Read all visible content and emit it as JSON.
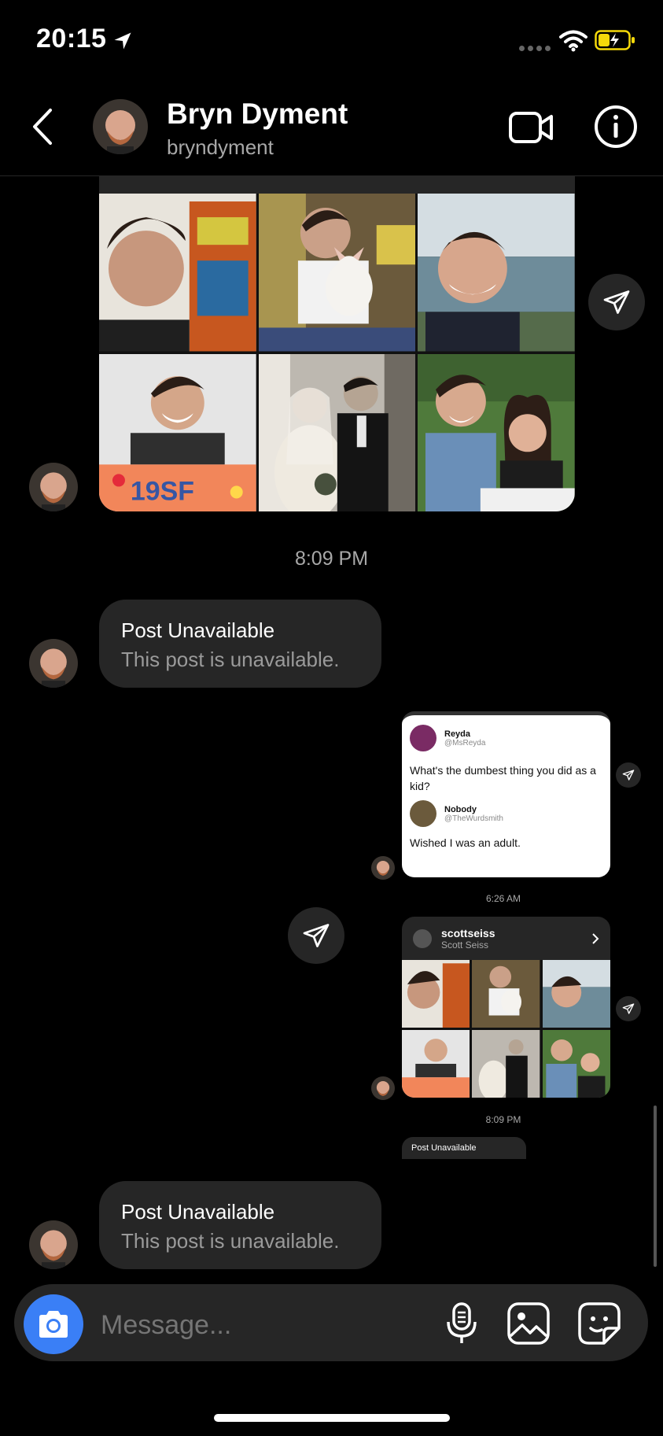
{
  "status_bar": {
    "time": "20:15"
  },
  "header": {
    "name": "Bryn Dyment",
    "username": "bryndyment"
  },
  "messages": {
    "time_1": "8:09 PM",
    "post_unavailable_1": {
      "title": "Post Unavailable",
      "body": "This post is unavailable."
    },
    "tweet": {
      "author1_name": "Reyda",
      "author1_handle": "@MsReyda",
      "question": "What's the dumbest thing you did as a kid?",
      "author2_name": "Nobody",
      "author2_handle": "@TheWurdsmith",
      "answer": "Wished I was an adult."
    },
    "time_small_1": "6:26 AM",
    "shared_post": {
      "username": "scottseiss",
      "fullname": "Scott Seiss"
    },
    "time_small_2": "8:09 PM",
    "mini_post_unavailable": "Post Unavailable",
    "post_unavailable_2": {
      "title": "Post Unavailable",
      "body": "This post is unavailable."
    }
  },
  "composer": {
    "placeholder": "Message..."
  },
  "colors": {
    "background": "#000000",
    "bubble": "#262626",
    "camera_button": "#3a7ff6",
    "battery": "#f5d90a"
  }
}
